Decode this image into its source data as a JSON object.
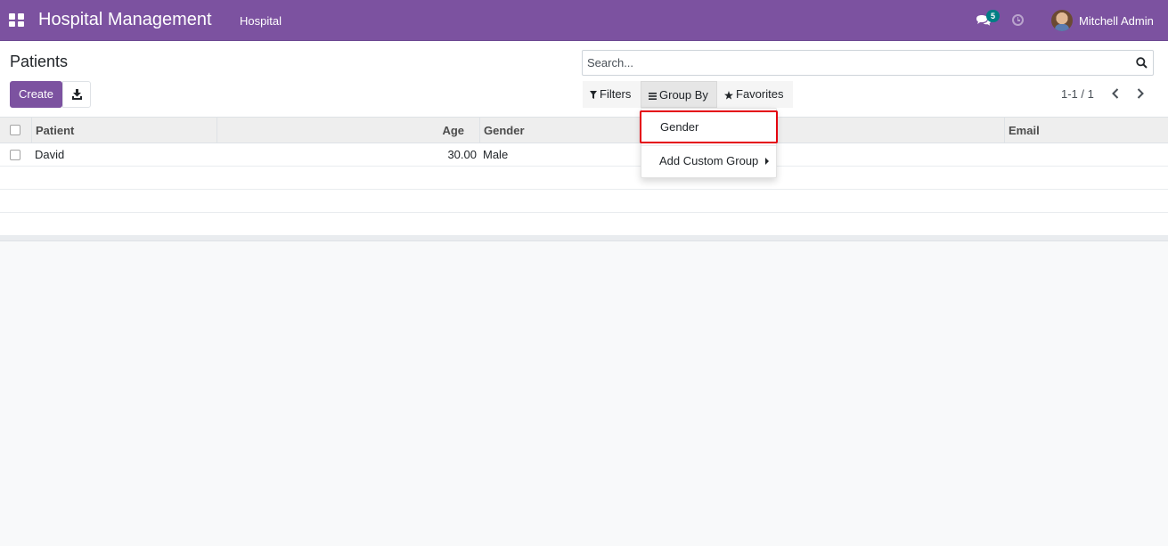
{
  "navbar": {
    "brand": "Hospital Management",
    "menu_items": [
      "Hospital"
    ],
    "messages_count": "5",
    "user_name": "Mitchell Admin"
  },
  "control_panel": {
    "title": "Patients",
    "create_label": "Create",
    "search_placeholder": "Search...",
    "filters_label": "Filters",
    "groupby_label": "Group By",
    "favorites_label": "Favorites",
    "pager": "1-1 / 1"
  },
  "table": {
    "columns": [
      "Patient",
      "Age",
      "Gender",
      "Email"
    ],
    "rows": [
      {
        "patient": "David",
        "age": "30.00",
        "gender": "Male",
        "email": ""
      }
    ]
  },
  "groupby_dropdown": {
    "items": [
      "Gender",
      "Add Custom Group"
    ]
  },
  "colors": {
    "brand": "#7c52a0",
    "highlight": "#e4000f",
    "badge": "#017e84"
  }
}
